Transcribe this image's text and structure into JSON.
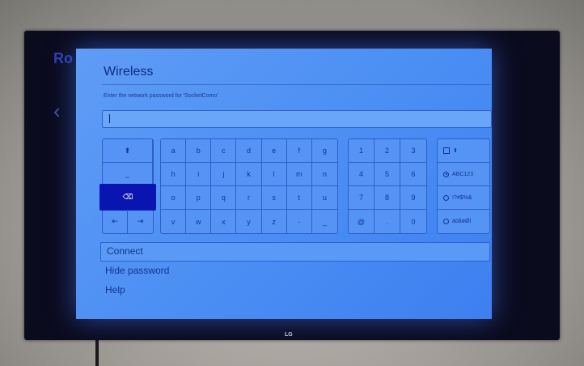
{
  "dialog": {
    "title": "Wireless",
    "prompt": "Enter the network password for 'SocketComo'",
    "password_value": ""
  },
  "keyboard": {
    "left_keys": [
      "⬆",
      "⎵",
      "⌫",
      "⇤",
      "⇥"
    ],
    "letters": [
      [
        "a",
        "b",
        "c",
        "d",
        "e",
        "f",
        "g"
      ],
      [
        "h",
        "i",
        "j",
        "k",
        "l",
        "m",
        "n"
      ],
      [
        "o",
        "p",
        "q",
        "r",
        "s",
        "t",
        "u"
      ],
      [
        "v",
        "w",
        "x",
        "y",
        "z",
        "-",
        "_"
      ]
    ],
    "numbers": [
      [
        "1",
        "2",
        "3"
      ],
      [
        "4",
        "5",
        "6"
      ],
      [
        "7",
        "8",
        "9"
      ],
      [
        "@",
        ".",
        "0"
      ]
    ],
    "modes": {
      "shift_symbol": "⬆",
      "abc": "ABC123",
      "symbols": "!?#$%&",
      "accents": "äöåøØI"
    },
    "selected_key": "backspace"
  },
  "menu": {
    "connect": "Connect",
    "hide_password": "Hide password",
    "help": "Help"
  },
  "tv": {
    "brand_text": "Ro",
    "logo": "LG"
  },
  "colors": {
    "screen": "#4a8ef4",
    "selected_key": "#0a14b0",
    "text": "#12348e"
  }
}
